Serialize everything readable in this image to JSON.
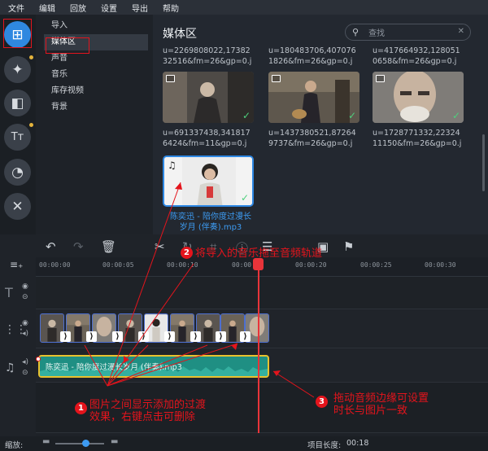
{
  "menu": [
    "文件",
    "编辑",
    "回放",
    "设置",
    "导出",
    "帮助"
  ],
  "sidebar_tools": [
    {
      "icon": "import-icon",
      "glyph": "⊞"
    },
    {
      "icon": "magic-wand-icon",
      "glyph": "✦"
    },
    {
      "icon": "transitions-icon",
      "glyph": "◧"
    },
    {
      "icon": "titles-icon",
      "glyph": "Tт"
    },
    {
      "icon": "stickers-icon",
      "glyph": "◔"
    },
    {
      "icon": "tools-icon",
      "glyph": "✕"
    }
  ],
  "nav": [
    "导入",
    "媒体区",
    "声音",
    "音乐",
    "库存视频",
    "背景"
  ],
  "media": {
    "title": "媒体区",
    "search_placeholder": "查找",
    "top_captions": [
      "u=2269808022,17382\n32516&fm=26&gp=0.j",
      "u=180483706,407076\n1826&fm=26&gp=0.j",
      "u=417664932,128051\n0658&fm=26&gp=0.j"
    ],
    "items": [
      {
        "caption": "u=691337438,341817\n6424&fm=11&gp=0.j",
        "color": "#5a5550"
      },
      {
        "caption": "u=1437380521,87264\n9737&fm=26&gp=0.j",
        "color": "#6b6357"
      },
      {
        "caption": "u=1728771332,22324\n11150&fm=26&gp=0.j",
        "color": "#8a8682"
      }
    ],
    "audio_caption": "陈奕迅 - 陪你度过漫长\n岁月 (伴奏).mp3"
  },
  "ruler": [
    "00:00:00",
    "00:00:05",
    "00:00:10",
    "00:00:15",
    "00:00:20",
    "00:00:25",
    "00:00:30"
  ],
  "audio_track_label": "陈奕迅 - 陪你度过漫长岁月 (伴奏).mp3",
  "annotations": {
    "a1": {
      "num": "1",
      "text": "图片之间显示添加的过渡\n效果，右键点击可删除"
    },
    "a2": {
      "num": "2",
      "text": "将导入的音乐拖至音频轨道"
    },
    "a3": {
      "num": "3",
      "text": "拖动音频边缘可设置\n时长与图片一致"
    }
  },
  "bottom": {
    "zoom_label": "缩放:",
    "length_label": "项目长度:",
    "length_value": "00:18"
  }
}
